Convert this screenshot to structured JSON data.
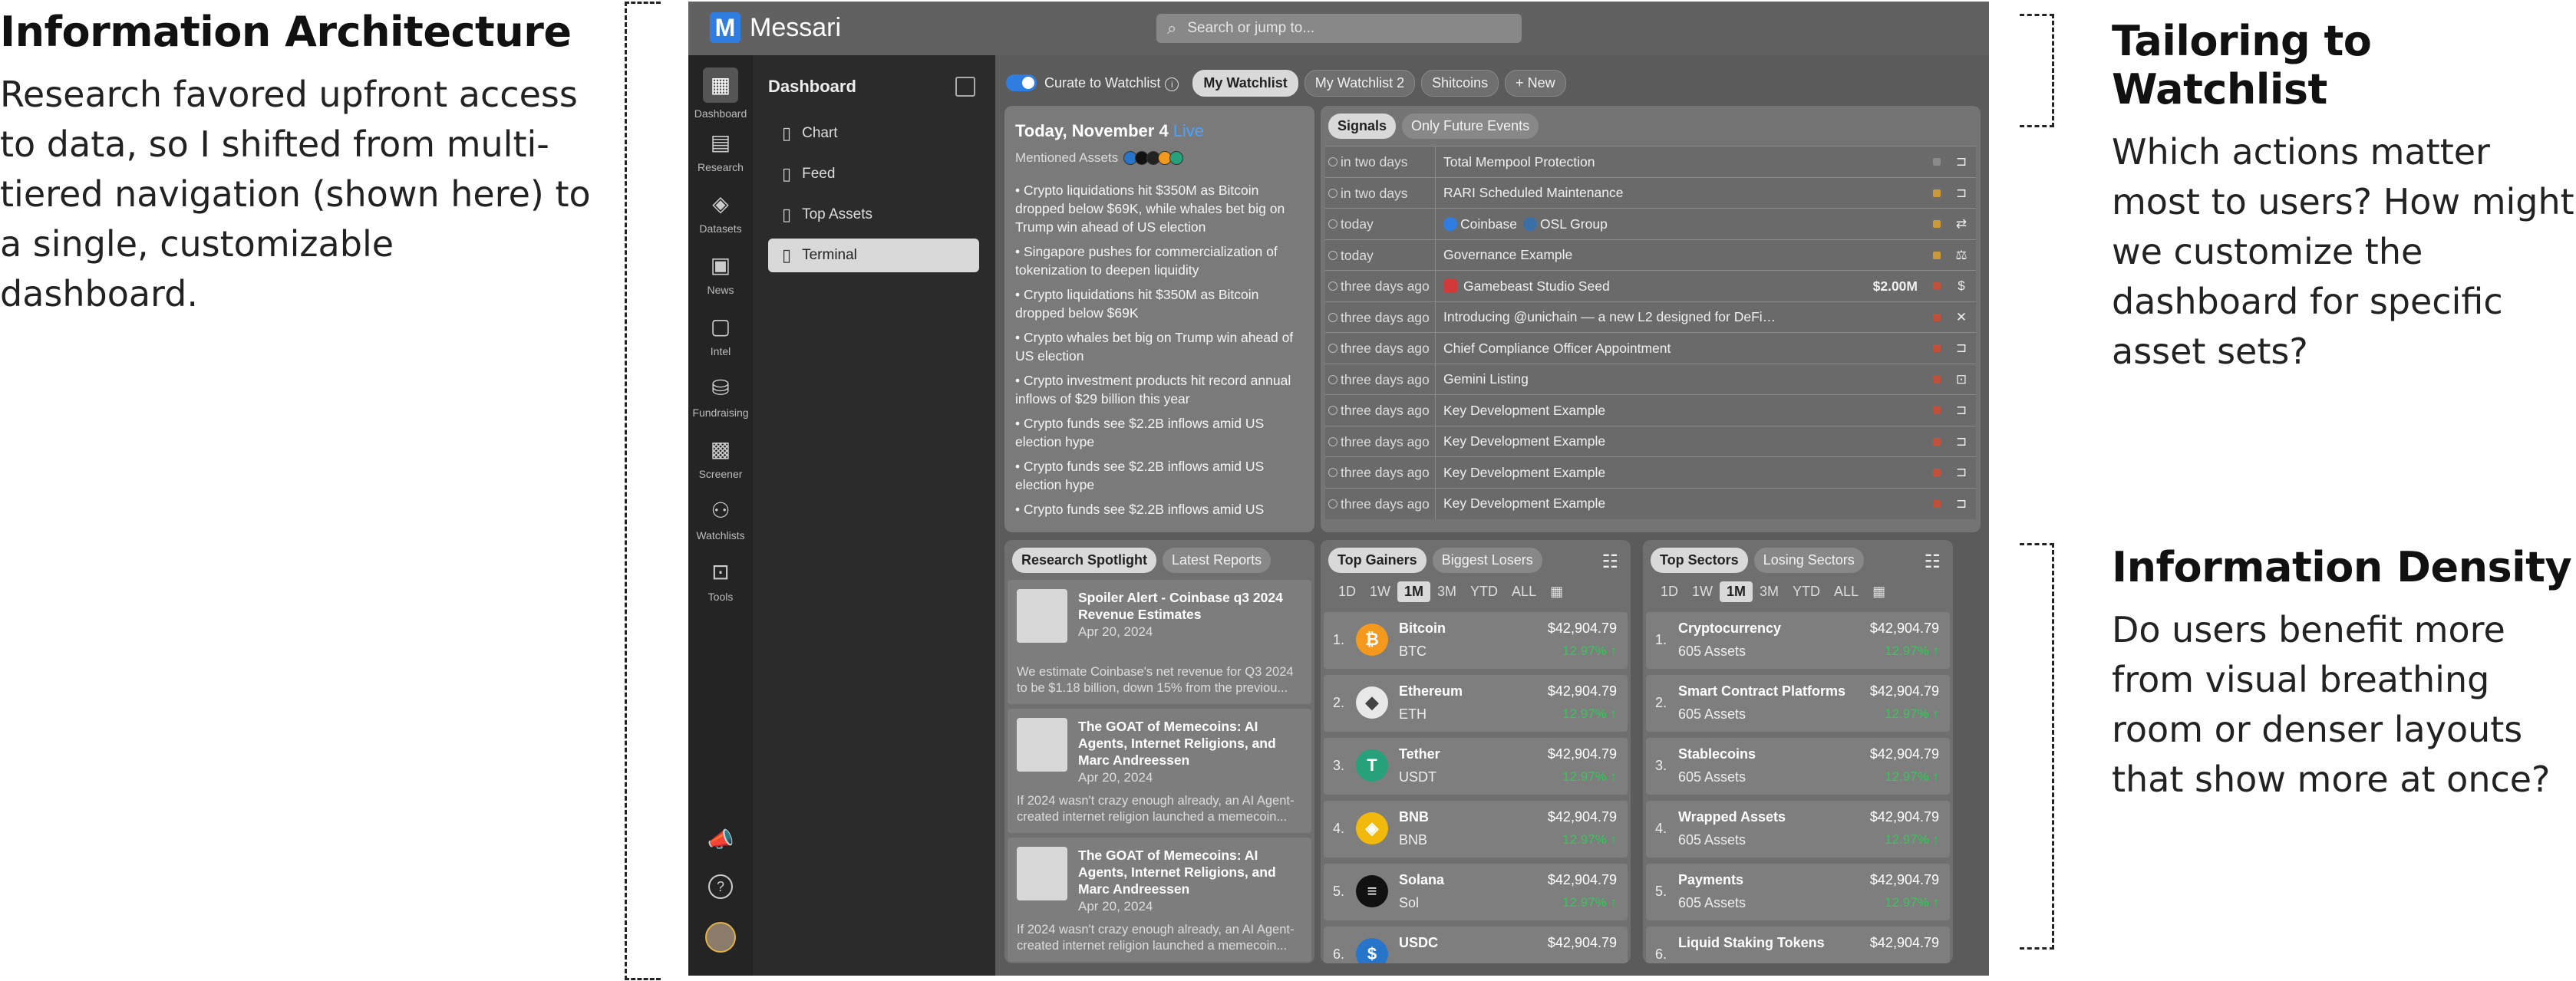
{
  "annotations": {
    "ia": {
      "heading": "Information Architecture",
      "body": "Research favored upfront access to data, so I shifted from multi-tiered navigation (shown here) to a single, customizable dashboard."
    },
    "tw": {
      "heading": "Tailoring to Watchlist",
      "body": "Which actions matter most to users? How might we customize the dashboard for specific asset sets?"
    },
    "id": {
      "heading": "Information Density",
      "body": "Do users benefit more from visual breathing room or denser layouts that show more at once?"
    }
  },
  "app": {
    "name": "Messari",
    "brand_color": "#2f7de1"
  },
  "search": {
    "placeholder": "Search or jump to..."
  },
  "rail": [
    {
      "label": "Dashboard",
      "icon": "dashboard-icon",
      "glyph": "▦"
    },
    {
      "label": "Research",
      "icon": "research-icon",
      "glyph": "▤"
    },
    {
      "label": "Datasets",
      "icon": "datasets-icon",
      "glyph": "◈"
    },
    {
      "label": "News",
      "icon": "news-icon",
      "glyph": "▣"
    },
    {
      "label": "Intel",
      "icon": "intel-icon",
      "glyph": "▢"
    },
    {
      "label": "Fundraising",
      "icon": "fundraising-icon",
      "glyph": "⛁"
    },
    {
      "label": "Screener",
      "icon": "screener-icon",
      "glyph": "▩"
    },
    {
      "label": "Watchlists",
      "icon": "watchlists-icon",
      "glyph": "⚇"
    },
    {
      "label": "Tools",
      "icon": "tools-icon",
      "glyph": "⊡"
    }
  ],
  "subnav": {
    "title": "Dashboard",
    "items": [
      {
        "label": "Chart"
      },
      {
        "label": "Feed"
      },
      {
        "label": "Top Assets"
      },
      {
        "label": "Terminal"
      }
    ]
  },
  "filters": {
    "toggle_label": "Curate to Watchlist",
    "pills": [
      {
        "label": "My Watchlist"
      },
      {
        "label": "My Watchlist 2"
      },
      {
        "label": "Shitcoins"
      },
      {
        "label": "+ New"
      }
    ]
  },
  "news": {
    "date": "Today, November 4",
    "live": "Live",
    "mentioned": "Mentioned Assets",
    "items": [
      "• Crypto liquidations hit $350M as Bitcoin dropped below $69K, while whales bet big on Trump win ahead of US election",
      "• Singapore pushes for commercialization of tokenization to deepen liquidity",
      "• Crypto liquidations hit $350M as Bitcoin dropped below $69K",
      "• Crypto whales bet big on Trump win ahead of US election",
      "• Crypto investment products hit record annual inflows of $29 billion this year",
      "• Crypto funds see $2.2B inflows amid US election hype",
      "• Crypto funds see $2.2B inflows amid US election hype",
      "• Crypto funds see $2.2B inflows amid US"
    ]
  },
  "signals": {
    "tabs": [
      {
        "label": "Signals"
      },
      {
        "label": "Only Future Events"
      }
    ],
    "rows": [
      {
        "when": "in two days",
        "title": "Total Mempool Protection",
        "flag": "#8a8a8a",
        "icon": "⊐"
      },
      {
        "when": "in two days",
        "title": "RARI Scheduled Maintenance",
        "flag": "#c99a3a",
        "icon": "⊐"
      },
      {
        "when": "today",
        "title": "",
        "chips": [
          "Coinbase",
          "OSL Group"
        ],
        "flag": "#c99a3a",
        "icon": "⇄"
      },
      {
        "when": "today",
        "title": "Governance Example",
        "flag": "#c99a3a",
        "icon": "⚖"
      },
      {
        "when": "three days ago",
        "title": "Gamebeast Studio Seed",
        "amount": "$2.00M",
        "flag": "#c0503a",
        "icon": "$"
      },
      {
        "when": "three days ago",
        "title": "Introducing @unichain — a new L2 designed for DeFi…",
        "flag": "#c0503a",
        "icon": "✕"
      },
      {
        "when": "three days ago",
        "title": "Chief Compliance Officer Appointment",
        "flag": "#c0503a",
        "icon": "⊐"
      },
      {
        "when": "three days ago",
        "title": "Gemini Listing",
        "flag": "#c0503a",
        "icon": "⊡"
      },
      {
        "when": "three days ago",
        "title": "Key Development Example",
        "flag": "#c0503a",
        "icon": "⊐"
      },
      {
        "when": "three days ago",
        "title": "Key Development Example",
        "flag": "#c0503a",
        "icon": "⊐"
      },
      {
        "when": "three days ago",
        "title": "Key Development Example",
        "flag": "#c0503a",
        "icon": "⊐"
      },
      {
        "when": "three days ago",
        "title": "Key Development Example",
        "flag": "#c0503a",
        "icon": "⊐"
      }
    ]
  },
  "research": {
    "tabs": [
      {
        "label": "Research Spotlight"
      },
      {
        "label": "Latest Reports"
      }
    ],
    "items": [
      {
        "title": "Spoiler Alert - Coinbase q3 2024 Revenue Estimates",
        "date": "Apr 20, 2024",
        "excerpt": "We estimate Coinbase's net revenue for Q3 2024 to be $1.18 billion, down 15% from the previou..."
      },
      {
        "title": "The GOAT of Memecoins: AI Agents, Internet Religions, and Marc Andreessen",
        "date": "Apr 20, 2024",
        "excerpt": "If 2024 wasn't crazy enough already, an AI Agent-created internet religion launched a memecoin..."
      },
      {
        "title": "The GOAT of Memecoins: AI Agents, Internet Religions, and Marc Andreessen",
        "date": "Apr 20, 2024",
        "excerpt": "If 2024 wasn't crazy enough already, an AI Agent-created internet religion launched a memecoin..."
      }
    ]
  },
  "ranges": [
    "1D",
    "1W",
    "1M",
    "3M",
    "YTD",
    "ALL"
  ],
  "gainers": {
    "tabs": [
      {
        "label": "Top Gainers"
      },
      {
        "label": "Biggest Losers"
      }
    ],
    "rows": [
      {
        "rank": "1.",
        "name": "Bitcoin",
        "symbol": "BTC",
        "price": "$42,904.79",
        "change": "12.97% ↑",
        "color": "#f39a1e",
        "glyph": "₿"
      },
      {
        "rank": "2.",
        "name": "Ethereum",
        "symbol": "ETH",
        "price": "$42,904.79",
        "change": "12.97% ↑",
        "color": "#e8e8e8",
        "glyph": "◆"
      },
      {
        "rank": "3.",
        "name": "Tether",
        "symbol": "USDT",
        "price": "$42,904.79",
        "change": "12.97% ↑",
        "color": "#26a17b",
        "glyph": "T"
      },
      {
        "rank": "4.",
        "name": "BNB",
        "symbol": "BNB",
        "price": "$42,904.79",
        "change": "12.97% ↑",
        "color": "#f0b90b",
        "glyph": "◈"
      },
      {
        "rank": "5.",
        "name": "Solana",
        "symbol": "Sol",
        "price": "$42,904.79",
        "change": "12.97% ↑",
        "color": "#111111",
        "glyph": "≡"
      },
      {
        "rank": "6.",
        "name": "USDC",
        "symbol": "",
        "price": "$42,904.79",
        "change": "",
        "color": "#2775ca",
        "glyph": "$"
      }
    ]
  },
  "sectors": {
    "tabs": [
      {
        "label": "Top Sectors"
      },
      {
        "label": "Losing Sectors"
      }
    ],
    "rows": [
      {
        "rank": "1.",
        "name": "Cryptocurrency",
        "symbol": "605 Assets",
        "price": "$42,904.79",
        "change": "12.97% ↑"
      },
      {
        "rank": "2.",
        "name": "Smart Contract Platforms",
        "symbol": "605 Assets",
        "price": "$42,904.79",
        "change": "12.97% ↑"
      },
      {
        "rank": "3.",
        "name": "Stablecoins",
        "symbol": "605 Assets",
        "price": "$42,904.79",
        "change": "12.97% ↑"
      },
      {
        "rank": "4.",
        "name": "Wrapped Assets",
        "symbol": "605 Assets",
        "price": "$42,904.79",
        "change": "12.97% ↑"
      },
      {
        "rank": "5.",
        "name": "Payments",
        "symbol": "605 Assets",
        "price": "$42,904.79",
        "change": "12.97% ↑"
      },
      {
        "rank": "6.",
        "name": "Liquid Staking Tokens",
        "symbol": "",
        "price": "$42,904.79",
        "change": ""
      }
    ]
  }
}
